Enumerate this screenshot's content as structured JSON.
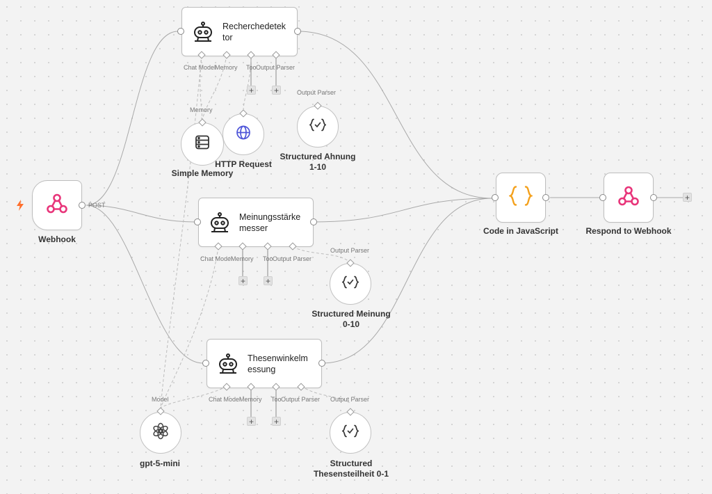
{
  "trigger": {
    "icon": "lightning-icon"
  },
  "nodes": {
    "webhook": {
      "label": "Webhook",
      "output_label": "POST",
      "icon": "webhook-icon"
    },
    "recherche": {
      "title": "Recherchedetek tor",
      "title_line1": "Recherchedetek",
      "title_line2": "tor",
      "icon": "robot-icon"
    },
    "meinung": {
      "title_line1": "Meinungsstärke",
      "title_line2": "messer",
      "icon": "robot-icon"
    },
    "thesen": {
      "title_line1": "Thesenwinkelm",
      "title_line2": "essung",
      "icon": "robot-icon"
    },
    "simple_memory": {
      "label": "Simple Memory",
      "icon": "database-icon"
    },
    "http_request": {
      "label": "HTTP Request",
      "icon": "globe-icon"
    },
    "structured_ahnung": {
      "label_line1": "Structured Ahnung",
      "label_line2": "1-10",
      "icon": "code-check-icon"
    },
    "structured_meinung": {
      "label_line1": "Structured Meinung",
      "label_line2": "0-10",
      "icon": "code-check-icon"
    },
    "structured_thesen": {
      "label_line1": "Structured",
      "label_line2": "Thesensteilheit 0-1",
      "icon": "code-check-icon"
    },
    "gpt": {
      "label": "gpt-5-mini",
      "icon": "openai-icon"
    },
    "code_js": {
      "label": "Code in JavaScript",
      "icon": "braces-icon"
    },
    "respond": {
      "label": "Respond to Webhook",
      "icon": "webhook-icon"
    }
  },
  "ports": {
    "chat_model": "Chat Model",
    "memory": "Memory",
    "tool": "Tool",
    "output_parser": "Output Parser",
    "model": "Model"
  },
  "colors": {
    "webhook_pink": "#e8357a",
    "code_orange": "#f4a11d",
    "globe_blue": "#4e55d8",
    "trigger_orange": "#ff6f2c"
  }
}
